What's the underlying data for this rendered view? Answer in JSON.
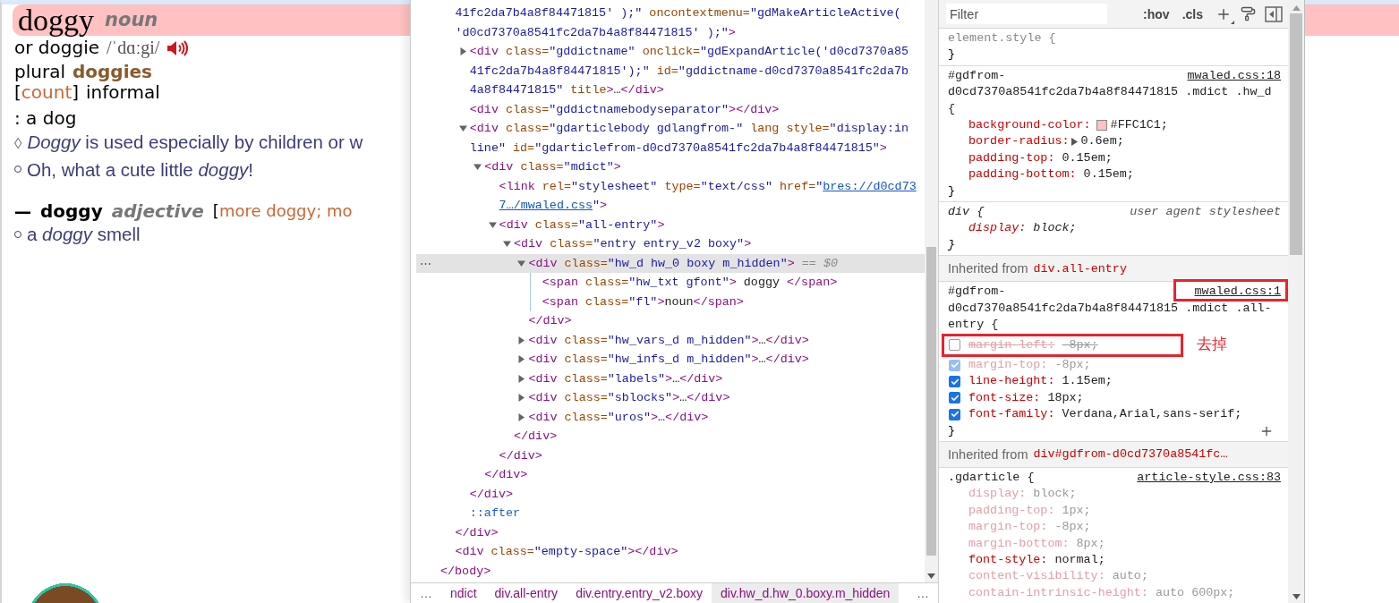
{
  "dictionary_entry": {
    "headword": "doggy",
    "part_of_speech": "noun",
    "variant": "or doggie",
    "pronunciation": "/ˈdɑːgi/",
    "plural_label": "plural",
    "plural": "doggies",
    "grammar": {
      "open": "[",
      "label": "count",
      "close": "]"
    },
    "usage_label": "informal",
    "definition": ": a dog",
    "usage_note": {
      "marker": "◊",
      "text": "*Doggy* is used especially by children or w"
    },
    "examples": [
      "Oh, what a cute little *doggy*!"
    ],
    "related": {
      "dash": "—",
      "headword": "doggy",
      "part_of_speech": "adjective",
      "bracket": "[",
      "forms": "more doggy; mo",
      "examples": [
        "a *doggy* smell"
      ]
    }
  },
  "elements_panel": {
    "row_menu": "⋯",
    "tree": [
      {
        "selected": false,
        "close": "</body>",
        "children": [
          {
            "selected": false,
            "lines": [
              [
                {
                  "kind": "value",
                  "text": "41fc2da7b4a8f84471815' );\""
                },
                {
                  "kind": "attr",
                  "text": " oncontextmenu="
                },
                {
                  "kind": "value",
                  "text": "\"gdMakeArticleActive("
                }
              ],
              [
                {
                  "kind": "value",
                  "text": "'d0cd7370a8541fc2da7b4a8f84471815' );\""
                },
                {
                  "kind": "tag",
                  "text": ">"
                }
              ]
            ],
            "close": "</div>",
            "children": [
              {
                "selected": false,
                "expanded": false,
                "lines": [
                  [
                    {
                      "kind": "tag",
                      "text": "<div"
                    },
                    {
                      "kind": "attr",
                      "text": " class="
                    },
                    {
                      "kind": "value",
                      "text": "\"gddictname\""
                    },
                    {
                      "kind": "attr",
                      "text": " onclick="
                    },
                    {
                      "kind": "value",
                      "text": "\"gdExpandArticle('d0cd7370a85"
                    }
                  ],
                  [
                    {
                      "kind": "value",
                      "text": "41fc2da7b4a8f84471815');\""
                    },
                    {
                      "kind": "attr",
                      "text": " id="
                    },
                    {
                      "kind": "value",
                      "text": "\"gddictname-d0cd7370a8541fc2da7b"
                    }
                  ],
                  [
                    {
                      "kind": "value",
                      "text": "4a8f84471815\""
                    },
                    {
                      "kind": "attr",
                      "text": " title"
                    },
                    {
                      "kind": "tag",
                      "text": ">"
                    },
                    {
                      "kind": "text",
                      "text": "…"
                    },
                    {
                      "kind": "tag",
                      "text": "</div>"
                    }
                  ]
                ]
              },
              {
                "selected": false,
                "lines": [
                  [
                    {
                      "kind": "tag",
                      "text": "<div"
                    },
                    {
                      "kind": "attr",
                      "text": " class="
                    },
                    {
                      "kind": "value",
                      "text": "\"gddictnamebodyseparator\""
                    },
                    {
                      "kind": "tag",
                      "text": "></div>"
                    }
                  ]
                ]
              },
              {
                "selected": false,
                "expanded": true,
                "lines": [
                  [
                    {
                      "kind": "tag",
                      "text": "<div"
                    },
                    {
                      "kind": "attr",
                      "text": " class="
                    },
                    {
                      "kind": "value",
                      "text": "\"gdarticlebody gdlangfrom-\""
                    },
                    {
                      "kind": "attr",
                      "text": " lang style="
                    },
                    {
                      "kind": "value",
                      "text": "\"display:in"
                    }
                  ],
                  [
                    {
                      "kind": "value",
                      "text": "line\""
                    },
                    {
                      "kind": "attr",
                      "text": " id="
                    },
                    {
                      "kind": "value",
                      "text": "\"gdarticlefrom-d0cd7370a8541fc2da7b4a8f84471815\""
                    },
                    {
                      "kind": "tag",
                      "text": ">"
                    }
                  ]
                ],
                "close": "</div>",
                "children": [
                  {
                    "selected": false,
                    "expanded": true,
                    "lines": [
                      [
                        {
                          "kind": "tag",
                          "text": "<div"
                        },
                        {
                          "kind": "attr",
                          "text": " class="
                        },
                        {
                          "kind": "value",
                          "text": "\"mdict\""
                        },
                        {
                          "kind": "tag",
                          "text": ">"
                        }
                      ]
                    ],
                    "close": "</div>",
                    "children": [
                      {
                        "selected": false,
                        "lines": [
                          [
                            {
                              "kind": "tag",
                              "text": "<link"
                            },
                            {
                              "kind": "attr",
                              "text": " rel="
                            },
                            {
                              "kind": "value",
                              "text": "\"stylesheet\""
                            },
                            {
                              "kind": "attr",
                              "text": " type="
                            },
                            {
                              "kind": "value",
                              "text": "\"text/css\""
                            },
                            {
                              "kind": "attr",
                              "text": " href="
                            },
                            {
                              "kind": "value",
                              "text": "\""
                            },
                            {
                              "kind": "link",
                              "text": "bres://d0cd73"
                            }
                          ],
                          [
                            {
                              "kind": "link",
                              "text": "7…/mwaled.css"
                            },
                            {
                              "kind": "value",
                              "text": "\""
                            },
                            {
                              "kind": "tag",
                              "text": ">"
                            }
                          ]
                        ]
                      },
                      {
                        "selected": false,
                        "expanded": true,
                        "lines": [
                          [
                            {
                              "kind": "tag",
                              "text": "<div"
                            },
                            {
                              "kind": "attr",
                              "text": " class="
                            },
                            {
                              "kind": "value",
                              "text": "\"all-entry\""
                            },
                            {
                              "kind": "tag",
                              "text": ">"
                            }
                          ]
                        ],
                        "close": "</div>",
                        "children": [
                          {
                            "selected": false,
                            "expanded": true,
                            "lines": [
                              [
                                {
                                  "kind": "tag",
                                  "text": "<div"
                                },
                                {
                                  "kind": "attr",
                                  "text": " class="
                                },
                                {
                                  "kind": "value",
                                  "text": "\"entry entry_v2 boxy\""
                                },
                                {
                                  "kind": "tag",
                                  "text": ">"
                                }
                              ]
                            ],
                            "close": "</div>",
                            "children": [
                              {
                                "selected": true,
                                "expanded": true,
                                "lines": [
                                  [
                                    {
                                      "kind": "tag",
                                      "text": "<div"
                                    },
                                    {
                                      "kind": "attr",
                                      "text": " class="
                                    },
                                    {
                                      "kind": "value",
                                      "text": "\"hw_d hw_0 boxy m_hidden\""
                                    },
                                    {
                                      "kind": "tag",
                                      "text": ">"
                                    },
                                    {
                                      "kind": "hint",
                                      "text": " == $0"
                                    }
                                  ]
                                ],
                                "close": "</div>",
                                "children": [
                                  {
                                    "selected": false,
                                    "lines": [
                                      [
                                        {
                                          "kind": "tag",
                                          "text": "<span"
                                        },
                                        {
                                          "kind": "attr",
                                          "text": " class="
                                        },
                                        {
                                          "kind": "value",
                                          "text": "\"hw_txt gfont\""
                                        },
                                        {
                                          "kind": "tag",
                                          "text": ">"
                                        },
                                        {
                                          "kind": "text",
                                          "text": " doggy "
                                        },
                                        {
                                          "kind": "tag",
                                          "text": "</span>"
                                        }
                                      ]
                                    ]
                                  },
                                  {
                                    "selected": false,
                                    "lines": [
                                      [
                                        {
                                          "kind": "tag",
                                          "text": "<span"
                                        },
                                        {
                                          "kind": "attr",
                                          "text": " class="
                                        },
                                        {
                                          "kind": "value",
                                          "text": "\"fl\""
                                        },
                                        {
                                          "kind": "tag",
                                          "text": ">"
                                        },
                                        {
                                          "kind": "text",
                                          "text": "noun"
                                        },
                                        {
                                          "kind": "tag",
                                          "text": "</span>"
                                        }
                                      ]
                                    ]
                                  }
                                ]
                              },
                              {
                                "selected": false,
                                "expanded": false,
                                "lines": [
                                  [
                                    {
                                      "kind": "tag",
                                      "text": "<div"
                                    },
                                    {
                                      "kind": "attr",
                                      "text": " class="
                                    },
                                    {
                                      "kind": "value",
                                      "text": "\"hw_vars_d m_hidden\""
                                    },
                                    {
                                      "kind": "tag",
                                      "text": ">"
                                    },
                                    {
                                      "kind": "text",
                                      "text": "…"
                                    },
                                    {
                                      "kind": "tag",
                                      "text": "</div>"
                                    }
                                  ]
                                ]
                              },
                              {
                                "selected": false,
                                "expanded": false,
                                "lines": [
                                  [
                                    {
                                      "kind": "tag",
                                      "text": "<div"
                                    },
                                    {
                                      "kind": "attr",
                                      "text": " class="
                                    },
                                    {
                                      "kind": "value",
                                      "text": "\"hw_infs_d m_hidden\""
                                    },
                                    {
                                      "kind": "tag",
                                      "text": ">"
                                    },
                                    {
                                      "kind": "text",
                                      "text": "…"
                                    },
                                    {
                                      "kind": "tag",
                                      "text": "</div>"
                                    }
                                  ]
                                ]
                              },
                              {
                                "selected": false,
                                "expanded": false,
                                "lines": [
                                  [
                                    {
                                      "kind": "tag",
                                      "text": "<div"
                                    },
                                    {
                                      "kind": "attr",
                                      "text": " class="
                                    },
                                    {
                                      "kind": "value",
                                      "text": "\"labels\""
                                    },
                                    {
                                      "kind": "tag",
                                      "text": ">"
                                    },
                                    {
                                      "kind": "text",
                                      "text": "…"
                                    },
                                    {
                                      "kind": "tag",
                                      "text": "</div>"
                                    }
                                  ]
                                ]
                              },
                              {
                                "selected": false,
                                "expanded": false,
                                "lines": [
                                  [
                                    {
                                      "kind": "tag",
                                      "text": "<div"
                                    },
                                    {
                                      "kind": "attr",
                                      "text": " class="
                                    },
                                    {
                                      "kind": "value",
                                      "text": "\"sblocks\""
                                    },
                                    {
                                      "kind": "tag",
                                      "text": ">"
                                    },
                                    {
                                      "kind": "text",
                                      "text": "…"
                                    },
                                    {
                                      "kind": "tag",
                                      "text": "</div>"
                                    }
                                  ]
                                ]
                              },
                              {
                                "selected": false,
                                "expanded": false,
                                "lines": [
                                  [
                                    {
                                      "kind": "tag",
                                      "text": "<div"
                                    },
                                    {
                                      "kind": "attr",
                                      "text": " class="
                                    },
                                    {
                                      "kind": "value",
                                      "text": "\"uros\""
                                    },
                                    {
                                      "kind": "tag",
                                      "text": ">"
                                    },
                                    {
                                      "kind": "text",
                                      "text": "…"
                                    },
                                    {
                                      "kind": "tag",
                                      "text": "</div>"
                                    }
                                  ]
                                ]
                              }
                            ]
                          }
                        ]
                      }
                    ]
                  }
                ]
              },
              {
                "selected": false,
                "lines": [
                  [
                    {
                      "kind": "pseudo",
                      "text": "::after"
                    }
                  ]
                ]
              }
            ]
          },
          {
            "selected": false,
            "lines": [
              [
                {
                  "kind": "tag",
                  "text": "<div"
                },
                {
                  "kind": "attr",
                  "text": " class="
                },
                {
                  "kind": "value",
                  "text": "\"empty-space\""
                },
                {
                  "kind": "tag",
                  "text": "></div>"
                }
              ]
            ]
          }
        ]
      }
    ],
    "breadcrumbs": {
      "scroll_left": "…",
      "scroll_right": "…",
      "items": [
        {
          "label": "ndict",
          "selected": false
        },
        {
          "label": "div.all-entry",
          "selected": false
        },
        {
          "label": "div.entry.entry_v2.boxy",
          "selected": false
        },
        {
          "label": "div.hw_d.hw_0.boxy.m_hidden",
          "selected": true
        }
      ]
    }
  },
  "styles_panel": {
    "filter": {
      "placeholder": "Filter"
    },
    "toggles": [
      ":hov",
      ".cls"
    ],
    "sections": [
      {
        "kind": "inline_rule",
        "selector_lines": [
          "element.style {"
        ],
        "close": "}"
      },
      {
        "kind": "author_rule",
        "source": "mwaled.css:18",
        "selector_lines": [
          "#gdfrom-",
          "d0cd7370a8541fc2da7b4a8f84471815 .mdict .hw_d",
          "{"
        ],
        "properties": [
          {
            "name": "background-color:",
            "value": "#FFC1C1;",
            "color": "#ffc1c1",
            "faded": false
          },
          {
            "name": "border-radius:",
            "value": "0.6em;",
            "expandable": true,
            "faded": false
          },
          {
            "name": "padding-top:",
            "value": "0.15em;",
            "faded": false
          },
          {
            "name": "padding-bottom:",
            "value": "0.15em;",
            "faded": false
          }
        ],
        "close": "}"
      },
      {
        "kind": "user_agent_rule",
        "source": "user agent stylesheet",
        "selector_lines": [
          "div {"
        ],
        "properties": [
          {
            "name": "display:",
            "value": "block;",
            "faded": false
          }
        ],
        "close": "}"
      },
      {
        "kind": "inherited",
        "label": "Inherited from",
        "element": "div.all-entry"
      },
      {
        "kind": "author_rule",
        "source": "mwaled.css:1",
        "source_highlighted": true,
        "show_add_button": true,
        "selector_lines": [
          "#gdfrom-",
          "d0cd7370a8541fc2da7b4a8f84471815 .mdict .all-",
          "entry {"
        ],
        "properties": [
          {
            "name": "margin-left:",
            "value": "-8px;",
            "checked": false,
            "faded": false,
            "highlighted": true,
            "note": "去掉"
          },
          {
            "name": "margin-top:",
            "value": "-8px;",
            "checked": true,
            "faded": true
          },
          {
            "name": "line-height:",
            "value": "1.15em;",
            "checked": true,
            "faded": false
          },
          {
            "name": "font-size:",
            "value": "18px;",
            "checked": true,
            "faded": false
          },
          {
            "name": "font-family:",
            "value": "Verdana,Arial,sans-serif;",
            "checked": true,
            "faded": false
          }
        ],
        "close": "}"
      },
      {
        "kind": "inherited",
        "label": "Inherited from",
        "element": "div#gdfrom-d0cd7370a8541fc…"
      },
      {
        "kind": "author_rule",
        "source": "article-style.css:83",
        "selector_lines": [
          ".gdarticle {"
        ],
        "properties": [
          {
            "name": "display:",
            "value": "block;",
            "faded": true
          },
          {
            "name": "padding-top:",
            "value": "1px;",
            "faded": true
          },
          {
            "name": "margin-top:",
            "value": "-8px;",
            "faded": true
          },
          {
            "name": "margin-bottom:",
            "value": "8px;",
            "faded": true
          },
          {
            "name": "font-style:",
            "value": "normal;",
            "faded": false
          },
          {
            "name": "content-visibility:",
            "value": "auto;",
            "faded": true
          },
          {
            "name": "contain-intrinsic-height:",
            "value": "auto 600px;",
            "faded": true
          }
        ]
      }
    ]
  }
}
